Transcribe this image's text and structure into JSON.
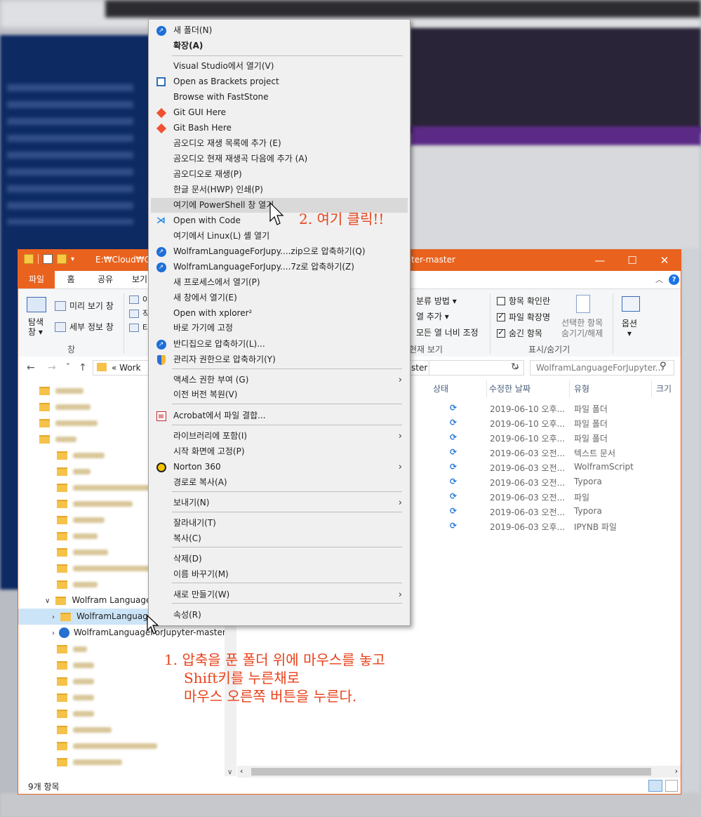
{
  "window": {
    "title_path": "E:₩Cloud₩One",
    "title_suffix": "ter-master",
    "minimize": "—",
    "maximize": "☐",
    "close": "✕"
  },
  "ribbon": {
    "tabs": {
      "file": "파일",
      "home": "홈",
      "share": "공유",
      "view": "보기"
    },
    "panes": {
      "nav_pane": "탐색\n창 ▾",
      "preview": "미리 보기 창",
      "details": "세부 정보 창",
      "group_label": "창"
    },
    "layout_partial": [
      "아",
      "작",
      "타"
    ],
    "current_view": {
      "group_by": "분류 방법 ▾",
      "add_column": "열 추가 ▾",
      "size_all": "모든 열 너비 조정",
      "group_label": "현재 보기"
    },
    "show_hide": {
      "item_checkbox": "항목 확인란",
      "item_checkbox_checked": false,
      "extensions": "파일 확장명",
      "extensions_checked": true,
      "hidden": "숨긴 항목",
      "hidden_checked": true,
      "hide_selected": "선택한 항목\n숨기기/해제",
      "group_label": "표시/숨기기"
    },
    "options": "옵션\n▾"
  },
  "address": {
    "back": "←",
    "forward": "→",
    "recent": "˅",
    "up": "↑",
    "crumb": "«  Work",
    "crumb_end": "ster",
    "refresh": "↻",
    "search_placeholder": "WolframLanguageForJupyter...",
    "search_icon": "⚲"
  },
  "navpane": {
    "wolfram_folder": "Wolfram Language",
    "selected": "WolframLanguageForJupyter-master",
    "zip": "WolframLanguageForJupyter-master.zi"
  },
  "columns": {
    "status": "상태",
    "modified": "수정한 날짜",
    "type": "유형",
    "size": "크기"
  },
  "rows": [
    {
      "status": "⟳",
      "date": "2019-06-10 오후...",
      "type": "파일 폴더"
    },
    {
      "status": "⟳",
      "date": "2019-06-10 오후...",
      "type": "파일 폴더"
    },
    {
      "status": "⟳",
      "date": "2019-06-10 오후...",
      "type": "파일 폴더"
    },
    {
      "status": "⟳",
      "date": "2019-06-03 오전...",
      "type": "텍스트 문서"
    },
    {
      "status": "⟳",
      "date": "2019-06-03 오전...",
      "type": "WolframScript"
    },
    {
      "status": "⟳",
      "date": "2019-06-03 오전...",
      "type": "Typora"
    },
    {
      "status": "⟳",
      "date": "2019-06-03 오전...",
      "type": "파일"
    },
    {
      "status": "⟳",
      "date": "2019-06-03 오전...",
      "type": "Typora"
    },
    {
      "status": "⟳",
      "date": "2019-06-03 오후...",
      "type": "IPYNB 파일"
    }
  ],
  "status_bar": "9개 항목",
  "context_menu": [
    "새 폴더(N)",
    "확장(A)",
    "Visual Studio에서 열기(V)",
    "Open as Brackets project",
    "Browse with FastStone",
    "Git GUI Here",
    "Git Bash Here",
    "곰오디오 재생 목록에 추가 (E)",
    "곰오디오 현재 재생곡 다음에 추가 (A)",
    "곰오디오로 재생(P)",
    "한글 문서(HWP) 인쇄(P)",
    "여기에 PowerShell 창 열기",
    "Open with Code",
    "여기에서 Linux(L) 셸 열기",
    "WolframLanguageForJupy....zip으로 압축하기(Q)",
    "WolframLanguageForJupy....7z로 압축하기(Z)",
    "새 프로세스에서 열기(P)",
    "새 창에서 열기(E)",
    "Open with xplorer²",
    "바로 가기에 고정",
    "반디집으로 압축하기(L)...",
    "관리자 권한으로 압축하기(Y)",
    "액세스 권한 부여 (G)",
    "이전 버전 복원(V)",
    "Acrobat에서 파일 결합...",
    "라이브러리에 포함(I)",
    "시작 화면에 고정(P)",
    "Norton 360",
    "경로로 복사(A)",
    "보내기(N)",
    "잘라내기(T)",
    "복사(C)",
    "삭제(D)",
    "이름 바꾸기(M)",
    "새로 만들기(W)",
    "속성(R)"
  ],
  "annotations": {
    "step2": "2. 여기 클릭!!",
    "step1_line1": "1. 압축을 푼 폴더 위에 마우스를 놓고",
    "step1_line2": "Shift키를 누른채로",
    "step1_line3": "마우스 오른쪽 버튼을 누른다."
  },
  "colors": {
    "accent": "#e9631f",
    "annotation": "#e8421a",
    "selection": "#cce4f7"
  }
}
